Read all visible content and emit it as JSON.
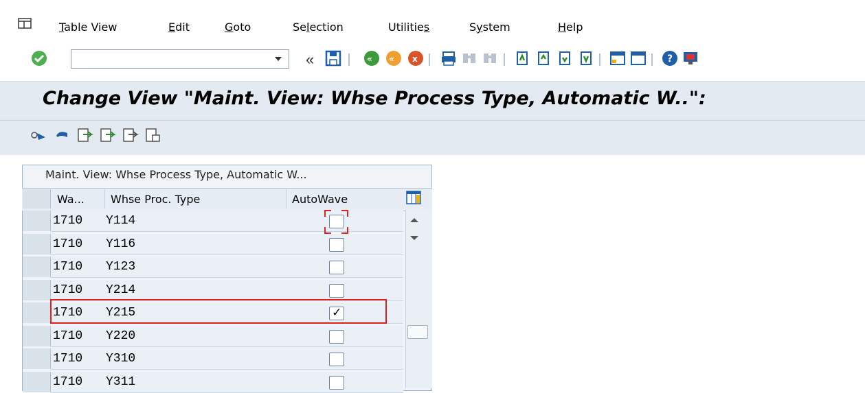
{
  "menu": {
    "items": [
      {
        "label": "Table View",
        "pre": "",
        "u": "T",
        "post": "able View"
      },
      {
        "label": "Edit",
        "pre": "",
        "u": "E",
        "post": "dit"
      },
      {
        "label": "Goto",
        "pre": "",
        "u": "G",
        "post": "oto"
      },
      {
        "label": "Selection",
        "pre": "Se",
        "u": "l",
        "post": "ection"
      },
      {
        "label": "Utilities",
        "pre": "Utilitie",
        "u": "s",
        "post": ""
      },
      {
        "label": "System",
        "pre": "S",
        "u": "y",
        "post": "stem"
      },
      {
        "label": "Help",
        "pre": "",
        "u": "H",
        "post": "elp"
      }
    ]
  },
  "toolbar": {
    "command_field_value": "",
    "back_label": "«"
  },
  "title": "Change View \"Maint. View: Whse Process Type, Automatic W..\":",
  "table": {
    "title": "Maint. View: Whse Process Type, Automatic W...",
    "columns": [
      "Wa...",
      "Whse Proc. Type",
      "AutoWave"
    ],
    "rows": [
      {
        "wa": "1710",
        "type": "Y114",
        "autowave": false
      },
      {
        "wa": "1710",
        "type": "Y116",
        "autowave": false
      },
      {
        "wa": "1710",
        "type": "Y123",
        "autowave": false
      },
      {
        "wa": "1710",
        "type": "Y214",
        "autowave": false
      },
      {
        "wa": "1710",
        "type": "Y215",
        "autowave": true
      },
      {
        "wa": "1710",
        "type": "Y220",
        "autowave": false
      },
      {
        "wa": "1710",
        "type": "Y310",
        "autowave": false
      },
      {
        "wa": "1710",
        "type": "Y311",
        "autowave": false
      }
    ]
  },
  "colors": {
    "highlight": "#e02020",
    "title_band": "#e3eaf1",
    "ok_green": "#4caf50"
  }
}
